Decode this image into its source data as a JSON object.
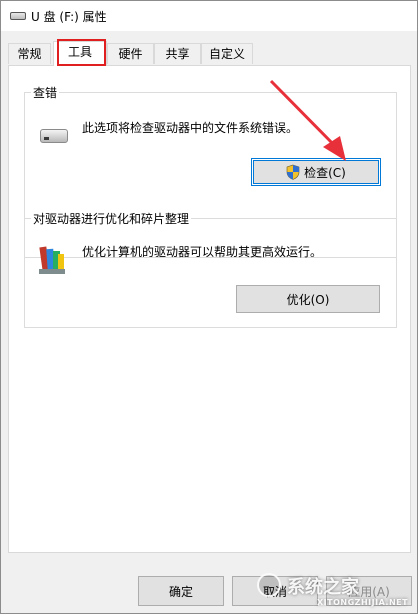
{
  "window": {
    "title": "U 盘 (F:) 属性"
  },
  "tabs": [
    {
      "label": "常规",
      "active": false
    },
    {
      "label": "工具",
      "active": true
    },
    {
      "label": "硬件",
      "active": false
    },
    {
      "label": "共享",
      "active": false
    },
    {
      "label": "自定义",
      "active": false
    }
  ],
  "error_check": {
    "group_title": "查错",
    "description": "此选项将检查驱动器中的文件系统错误。",
    "button_label": "检查(C)",
    "icon": "drive-icon"
  },
  "optimize": {
    "group_title": "对驱动器进行优化和碎片整理",
    "description": "优化计算机的驱动器可以帮助其更高效运行。",
    "button_label": "优化(O)",
    "icon": "defrag-icon"
  },
  "footer": {
    "ok_label": "确定",
    "cancel_label": "取消",
    "apply_label": "应用(A)"
  },
  "watermark": {
    "text": "系统之家",
    "url": "XITONGZHIJIA.NET"
  },
  "colors": {
    "highlight_box": "#e02020",
    "annotation_arrow": "#e8303a",
    "focus_border": "#0078d7"
  }
}
